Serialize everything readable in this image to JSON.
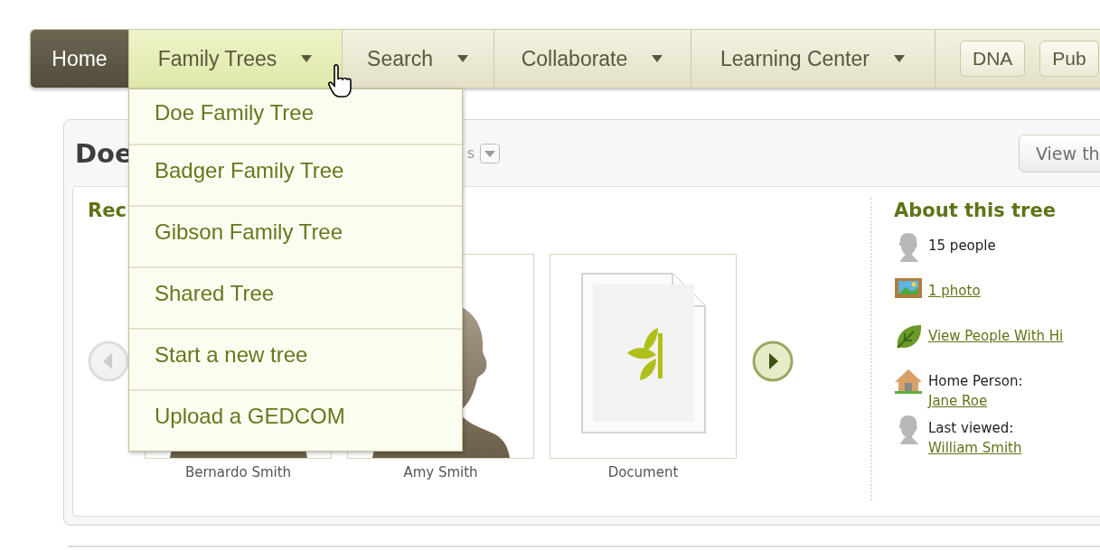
{
  "nav": {
    "items": [
      {
        "label": "Home",
        "kind": "home",
        "selected": false,
        "has_menu": false
      },
      {
        "label": "Family Trees",
        "kind": "tab",
        "selected": true,
        "has_menu": true
      },
      {
        "label": "Search",
        "kind": "tab",
        "selected": false,
        "has_menu": true
      },
      {
        "label": "Collaborate",
        "kind": "tab",
        "selected": false,
        "has_menu": true
      },
      {
        "label": "Learning Center",
        "kind": "tab",
        "selected": false,
        "has_menu": true
      }
    ],
    "buttons": [
      "DNA",
      "Pub"
    ]
  },
  "menu": {
    "items": [
      "Doe Family Tree",
      "Badger Family Tree",
      "Gibson Family Tree",
      "Shared Tree",
      "Start a new tree",
      "Upload a GEDCOM"
    ]
  },
  "tree": {
    "title": "Doe",
    "options_label": "s",
    "view_button": "View th",
    "section_heading": "Rec",
    "carousel": {
      "prev_enabled": false,
      "next_enabled": true
    },
    "media": [
      {
        "caption": "Bernardo Smith",
        "kind": "person"
      },
      {
        "caption": "Amy Smith",
        "kind": "person"
      },
      {
        "caption": "Document",
        "kind": "document"
      }
    ]
  },
  "about": {
    "heading": "About this tree",
    "items": [
      {
        "kind": "people",
        "text": "15 people"
      },
      {
        "kind": "photo",
        "link": "1 photo"
      },
      {
        "kind": "hints",
        "link": "View People With Hi"
      },
      {
        "kind": "home",
        "label": "Home Person:",
        "link": "Jane Roe"
      },
      {
        "kind": "viewed",
        "label": "Last viewed:",
        "link": "William Smith"
      }
    ]
  }
}
